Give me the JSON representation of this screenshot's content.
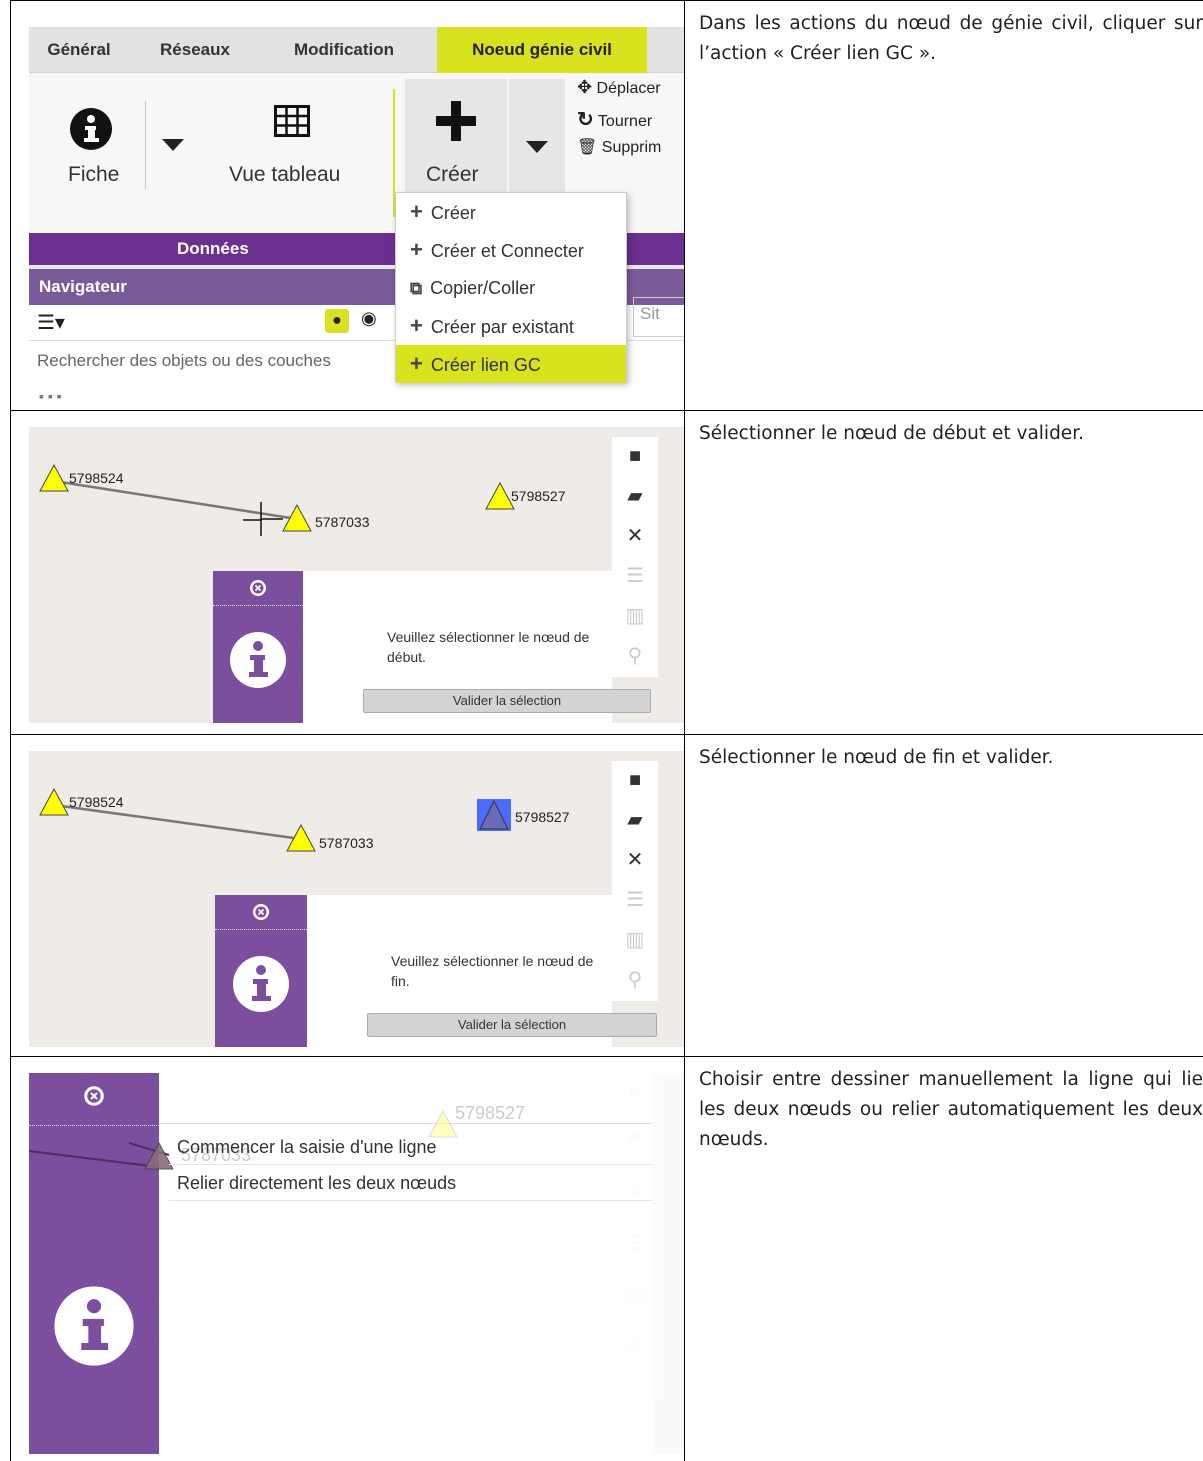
{
  "row1": {
    "tabs": [
      "Général",
      "Réseaux",
      "Modification",
      "Noeud génie civil"
    ],
    "ribbon": {
      "fiche_label": "Fiche",
      "vue_tableau_label": "Vue tableau",
      "creer_label": "Créer",
      "deplacer_label": "Déplacer",
      "tourner_label": "Tourner",
      "supprimer_label": "Supprim",
      "group_label": "Données"
    },
    "dropdown": [
      "Créer",
      "Créer et Connecter",
      "Copier/Coller",
      "Créer par existant",
      "Créer lien GC"
    ],
    "navigator": {
      "title": "Navigateur",
      "search_placeholder": "Rechercher des objets ou des couches",
      "site_partial": "Sit"
    },
    "instruction": "Dans les actions du nœud de génie civil, cliquer sur l’action « Créer lien GC »."
  },
  "row2": {
    "nodes": [
      "5798524",
      "5787033",
      "5798527"
    ],
    "message": "Veuillez sélectionner le nœud de début.",
    "button": "Valider la sélection",
    "instruction": "Sélectionner le nœud de début et valider."
  },
  "row3": {
    "nodes": [
      "5798524",
      "5787033",
      "5798527"
    ],
    "message": "Veuillez sélectionner le nœud de fin.",
    "button": "Valider la sélection",
    "instruction": "Sélectionner le nœud de fin et valider."
  },
  "row4": {
    "faint_nodes": [
      "5798527",
      "5787033"
    ],
    "options": [
      "Commencer la saisie d'une ligne",
      "Relier directement les deux nœuds"
    ],
    "instruction": "Choisir entre dessiner manuellement la ligne qui lie les deux nœuds ou relier automatiquement les deux nœuds."
  },
  "colors": {
    "accent_yellow": "#d9e21f",
    "purple_dark": "#6b2f8f",
    "purple_panel": "#7b4f9d",
    "node_yellow": "#ffff00",
    "node_selected": "#6a6ab8"
  }
}
